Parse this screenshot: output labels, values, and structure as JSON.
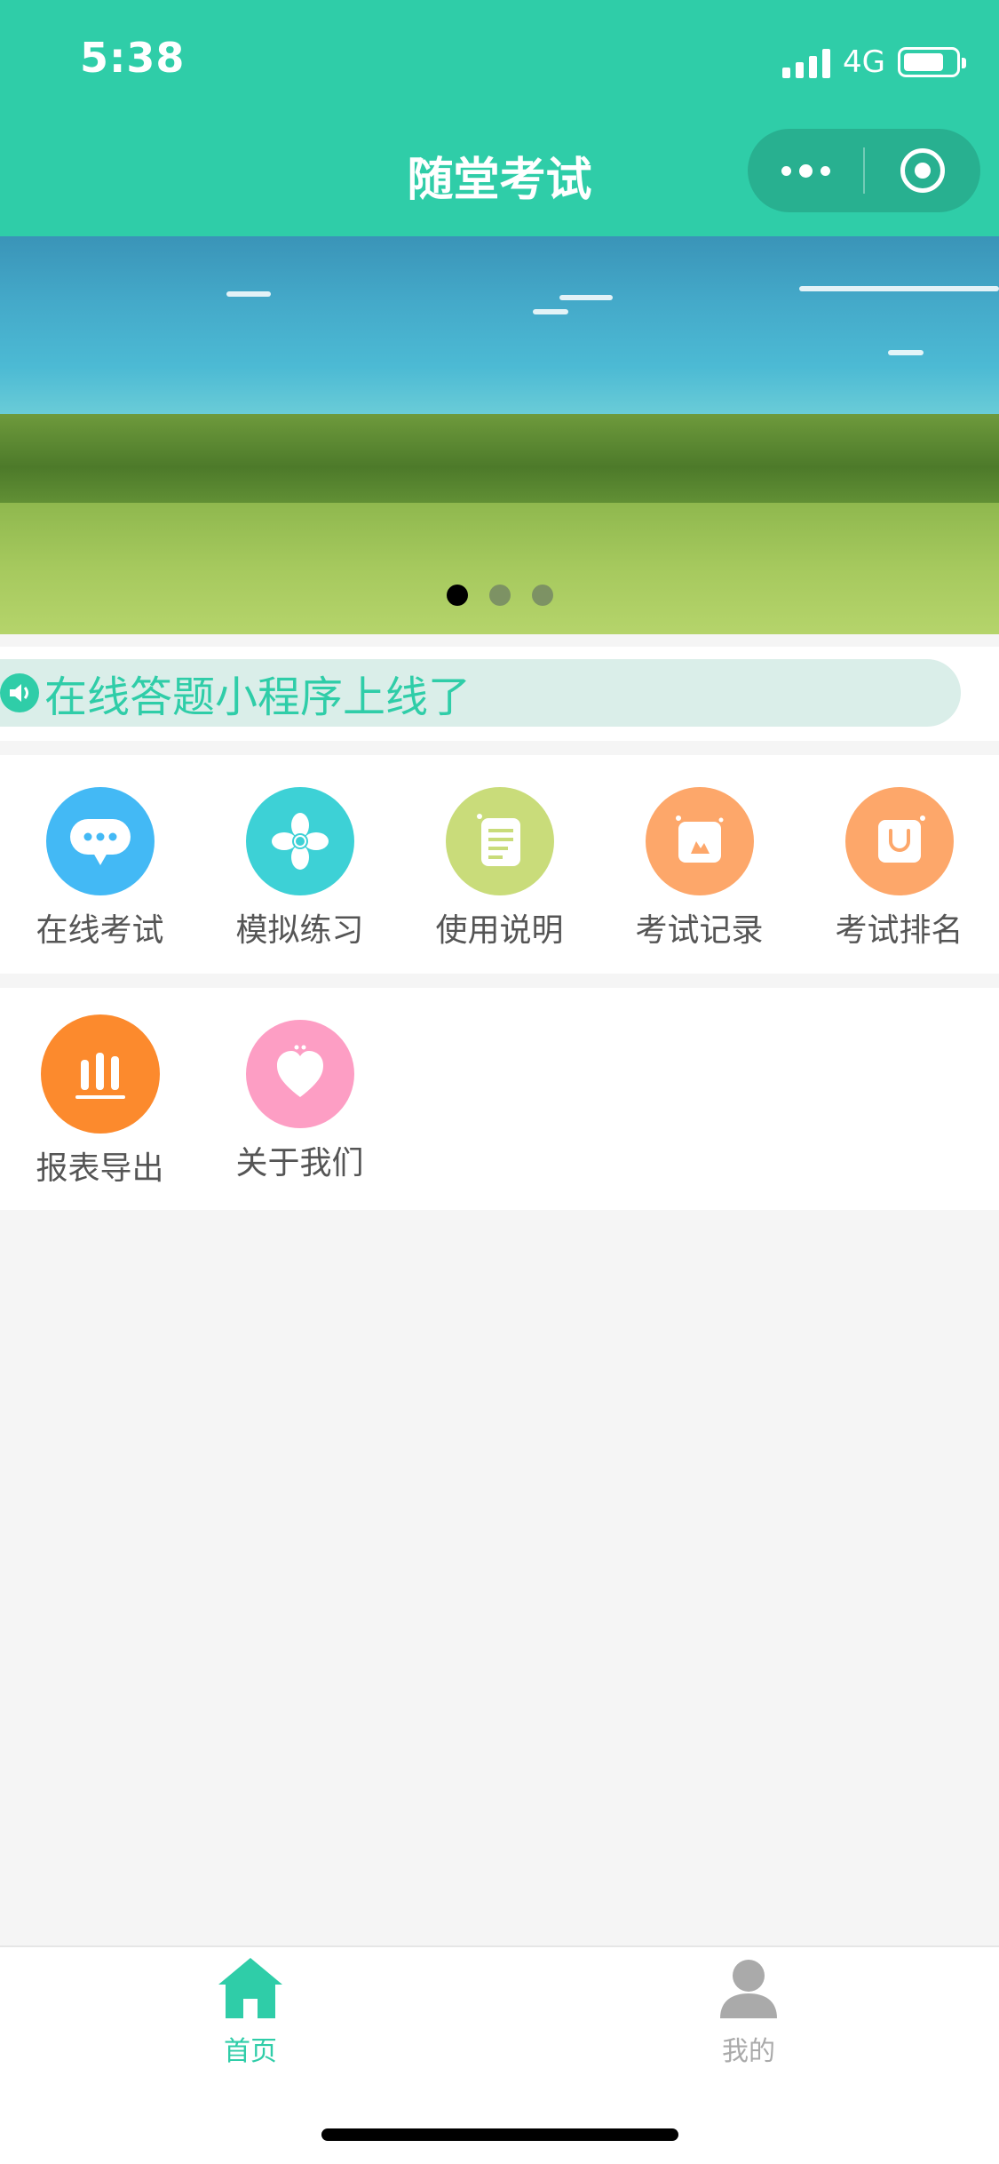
{
  "status_bar": {
    "time": "5:38",
    "network": "4G"
  },
  "nav": {
    "title": "随堂考试",
    "more_icon": "more-dots-icon",
    "close_icon": "target-circle-icon"
  },
  "banner": {
    "slide_count": 3,
    "active_index": 0
  },
  "notice": {
    "icon": "speaker-icon",
    "text": "在线答题小程序上线了"
  },
  "grid": {
    "row1": [
      {
        "label": "在线考试",
        "icon": "chat-bubble-icon",
        "color": "#43b9f5"
      },
      {
        "label": "模拟练习",
        "icon": "flower-icon",
        "color": "#3dd1d6"
      },
      {
        "label": "使用说明",
        "icon": "document-icon",
        "color": "#c9dc7a"
      },
      {
        "label": "考试记录",
        "icon": "photo-icon",
        "color": "#fda76a"
      },
      {
        "label": "考试排名",
        "icon": "bag-icon",
        "color": "#fda76a"
      }
    ],
    "row2": [
      {
        "label": "报表导出",
        "icon": "bar-chart-icon",
        "color": "#fc8a2d"
      },
      {
        "label": "关于我们",
        "icon": "heart-icon",
        "color": "#fd9ec4"
      }
    ]
  },
  "tabbar": {
    "tabs": [
      {
        "label": "首页",
        "icon": "home-icon",
        "active": true
      },
      {
        "label": "我的",
        "icon": "user-icon",
        "active": false
      }
    ],
    "active_color": "#2fcda8",
    "inactive_color": "#aaaaaa"
  },
  "colors": {
    "primary": "#2fcda8",
    "notice_bg": "#daeee9"
  }
}
